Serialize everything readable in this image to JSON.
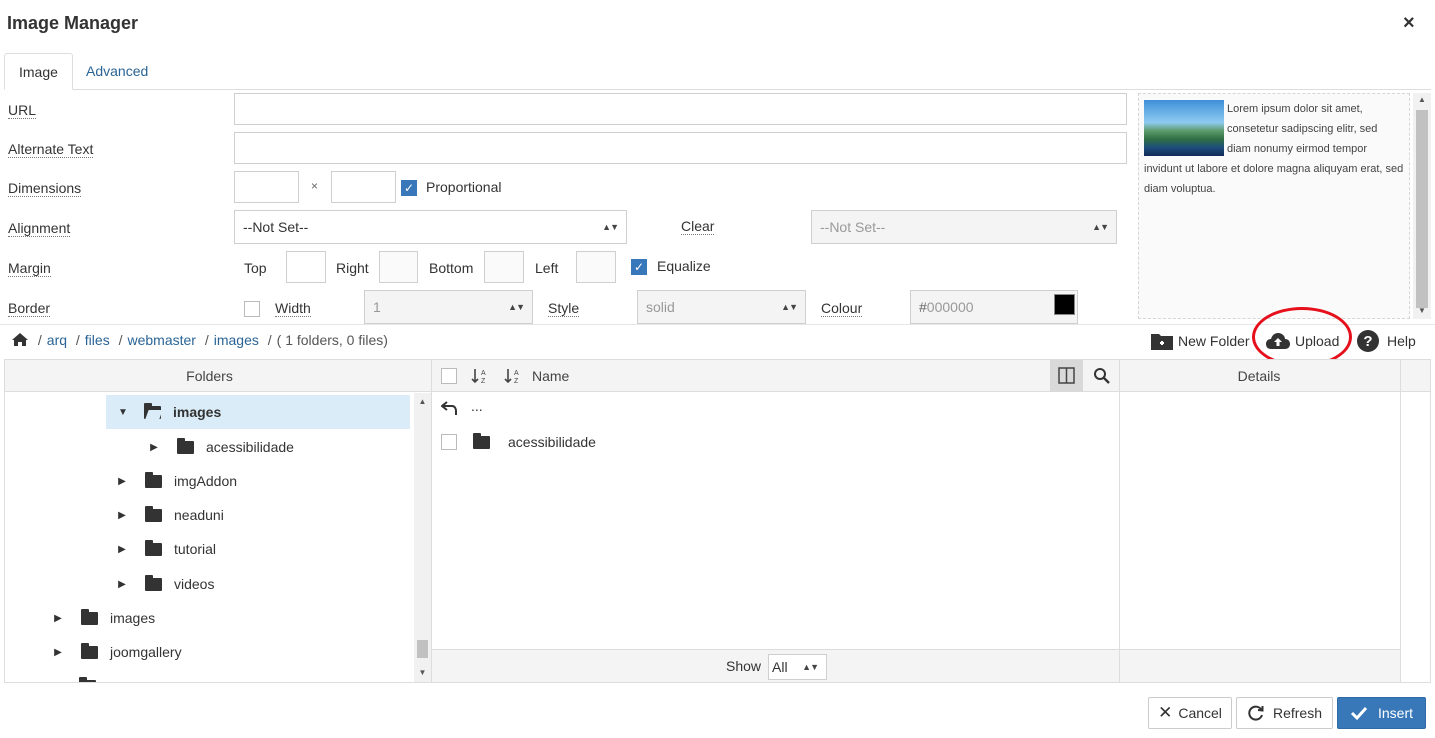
{
  "dialog": {
    "title": "Image Manager",
    "close_symbol": "×"
  },
  "tabs": [
    {
      "label": "Image",
      "active": true
    },
    {
      "label": "Advanced",
      "active": false
    }
  ],
  "form": {
    "url_label": "URL",
    "alt_label": "Alternate Text",
    "dimensions_label": "Dimensions",
    "dimensions_sep": "×",
    "proportional_label": "Proportional",
    "alignment_label": "Alignment",
    "alignment_value": "--Not Set--",
    "clear_label": "Clear",
    "clear_value": "--Not Set--",
    "margin_label": "Margin",
    "margin_top": "Top",
    "margin_right": "Right",
    "margin_bottom": "Bottom",
    "margin_left": "Left",
    "equalize_label": "Equalize",
    "border_label": "Border",
    "width_label": "Width",
    "width_value": "1",
    "style_label": "Style",
    "style_value": "solid",
    "colour_label": "Colour",
    "colour_hash": "#",
    "colour_placeholder": "000000",
    "colour_swatch": "#000000"
  },
  "preview": {
    "text": "Lorem ipsum dolor sit amet, consetetur sadipscing elitr, sed diam nonumy eirmod tempor invidunt ut labore et dolore magna aliquyam erat, sed diam voluptua."
  },
  "breadcrumb": {
    "segments": [
      "arq",
      "files",
      "webmaster",
      "images"
    ],
    "sep": "/",
    "summary": "( 1 folders, 0 files)"
  },
  "toolbar": {
    "new_folder": "New Folder",
    "upload": "Upload",
    "help": "Help"
  },
  "folders_panel": {
    "header": "Folders",
    "items": [
      {
        "label": "images",
        "level": 2,
        "selected": true,
        "expanded": true
      },
      {
        "label": "acessibilidade",
        "level": 3
      },
      {
        "label": "imgAddon",
        "level": 2
      },
      {
        "label": "neaduni",
        "level": 2
      },
      {
        "label": "tutorial",
        "level": 2
      },
      {
        "label": "videos",
        "level": 2
      },
      {
        "label": "images",
        "level": 1
      },
      {
        "label": "joomgallery",
        "level": 1
      }
    ]
  },
  "files_panel": {
    "name_header": "Name",
    "up_label": "...",
    "items": [
      {
        "label": "acessibilidade",
        "type": "folder"
      }
    ],
    "show_label": "Show",
    "show_value": "All"
  },
  "details_panel": {
    "header": "Details"
  },
  "footer": {
    "cancel": "Cancel",
    "refresh": "Refresh",
    "insert": "Insert"
  },
  "colors": {
    "accent": "#3878b8",
    "link": "#2a6496",
    "annotation": "#e5101c",
    "selected_row": "#d9ecf7"
  }
}
